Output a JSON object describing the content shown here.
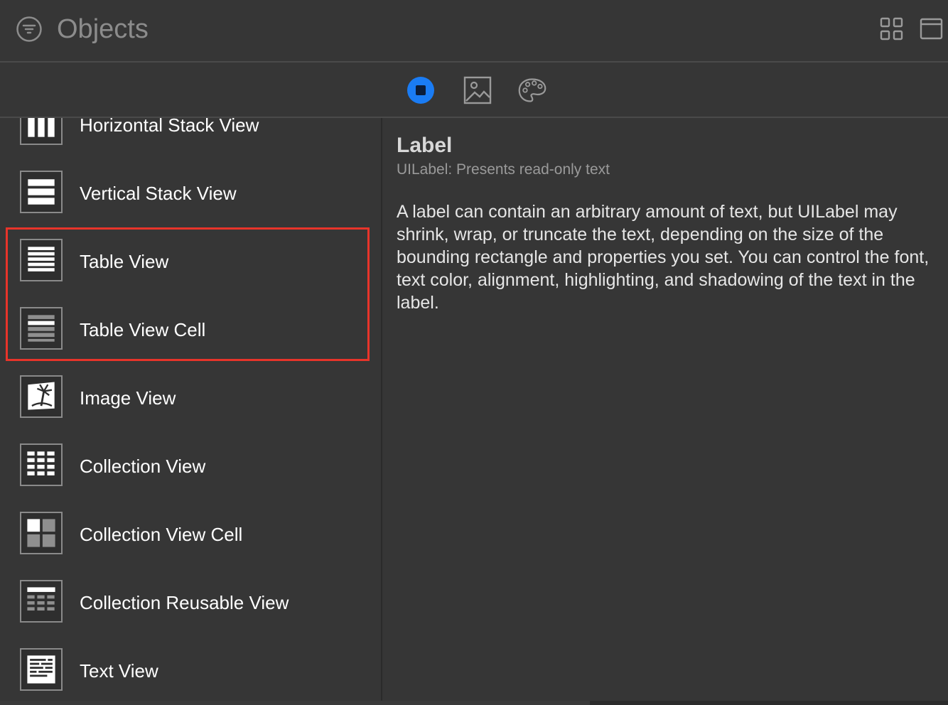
{
  "header": {
    "title": "Objects",
    "filter_icon": "filter-circle-icon",
    "grid_icon": "grid-view-icon",
    "window_icon": "window-icon"
  },
  "toolbar": {
    "objects_icon": "objects-library-icon",
    "media_icon": "media-library-icon",
    "colors_icon": "color-palette-icon",
    "accent": "#1a7cf4"
  },
  "library": {
    "items": [
      {
        "label": "Horizontal Stack View",
        "icon": "horizontal-stack-view-icon"
      },
      {
        "label": "Vertical Stack View",
        "icon": "vertical-stack-view-icon"
      },
      {
        "label": "Table View",
        "icon": "table-view-icon"
      },
      {
        "label": "Table View Cell",
        "icon": "table-view-cell-icon"
      },
      {
        "label": "Image View",
        "icon": "image-view-icon"
      },
      {
        "label": "Collection View",
        "icon": "collection-view-icon"
      },
      {
        "label": "Collection View Cell",
        "icon": "collection-view-cell-icon"
      },
      {
        "label": "Collection Reusable View",
        "icon": "collection-reusable-view-icon"
      },
      {
        "label": "Text View",
        "icon": "text-view-icon"
      }
    ],
    "highlight_color": "#e8342a"
  },
  "detail": {
    "title": "Label",
    "subtitle": "UILabel: Presents read-only text",
    "description": "A label can contain an arbitrary amount of text, but UILabel may shrink, wrap, or truncate the text, depending on the size of the bounding rectangle and properties you set. You can control the font, text color, alignment, highlighting, and shadowing of the text in the label."
  }
}
